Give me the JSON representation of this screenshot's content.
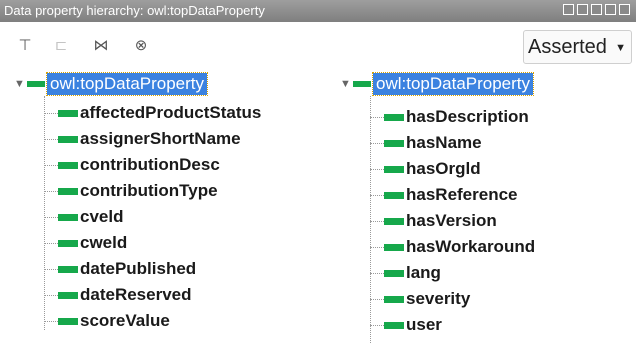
{
  "window": {
    "title": "Data property hierarchy: owl:topDataProperty"
  },
  "toolbar": {
    "icons": [
      "add-subproperty-icon",
      "add-sibling-icon",
      "delete-icon",
      "close-circle-icon"
    ],
    "mode_select": "Asserted"
  },
  "left_tree": {
    "root": "owl:topDataProperty",
    "children": [
      "affectedProductStatus",
      "assignerShortName",
      "contributionDesc",
      "contributionType",
      "cveld",
      "cweld",
      "datePublished",
      "dateReserved",
      "scoreValue"
    ]
  },
  "right_tree": {
    "root": "owl:topDataProperty",
    "children": [
      "hasDescription",
      "hasName",
      "hasOrgld",
      "hasReference",
      "hasVersion",
      "hasWorkaround",
      "lang",
      "severity",
      "user"
    ]
  },
  "colors": {
    "accent": "#3b82e0",
    "property": "#16a84b",
    "titlebar": "#8a8a8a"
  }
}
